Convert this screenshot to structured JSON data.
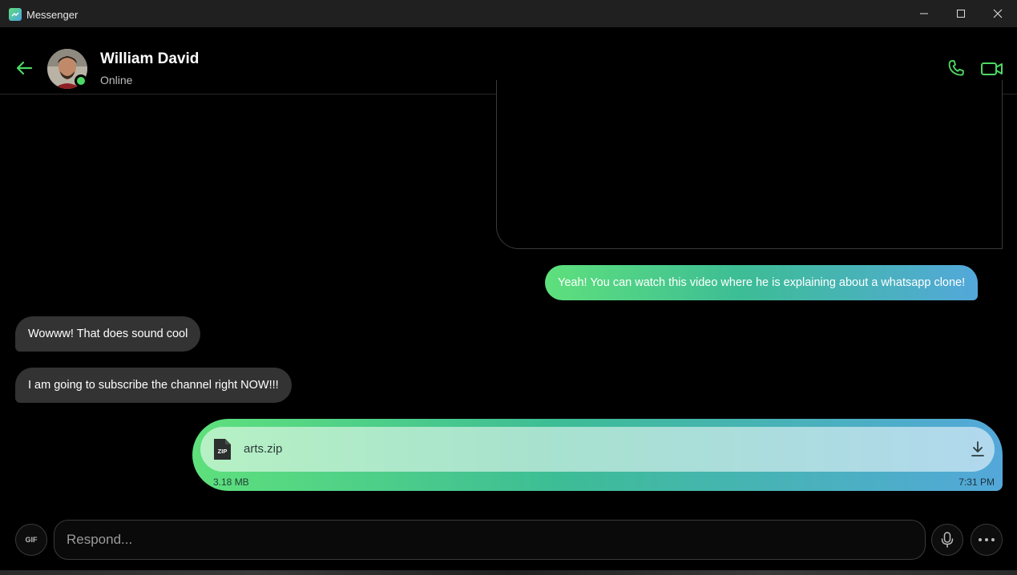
{
  "window": {
    "title": "Messenger",
    "icon": "messenger-app-icon",
    "accent": "#4cd964"
  },
  "header": {
    "contact_name": "William David",
    "status": "Online",
    "icons": [
      "back-arrow-icon",
      "phone-icon",
      "video-camera-icon"
    ]
  },
  "messages": [
    {
      "direction": "outgoing",
      "type": "text",
      "text": "Yeah! You can watch this video where he is explaining about a whatsapp clone!"
    },
    {
      "direction": "incoming",
      "type": "text",
      "text": "Wowww! That does sound cool"
    },
    {
      "direction": "incoming",
      "type": "text",
      "text": "I am going to subscribe the channel right NOW!!!"
    },
    {
      "direction": "outgoing",
      "type": "file",
      "file_badge": "ZIP",
      "file_name": "arts.zip",
      "file_size": "3.18 MB",
      "time": "7:31 PM"
    }
  ],
  "composer": {
    "gif_label": "GIF",
    "placeholder": "Respond..."
  },
  "colors": {
    "outgoing_gradient_start": "#5ee07c",
    "outgoing_gradient_end": "#53a8da",
    "incoming_bubble": "#333333",
    "background": "#000000"
  }
}
